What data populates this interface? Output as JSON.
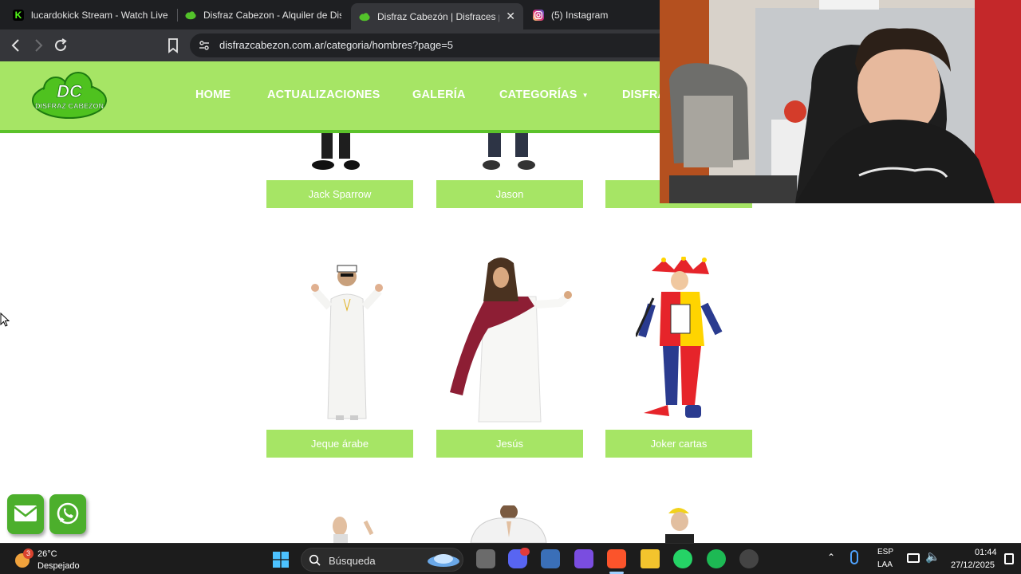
{
  "browser": {
    "tabs": [
      {
        "title": "lucardokick Stream - Watch Live o",
        "favicon": "kick-icon",
        "color": "#53fc18"
      },
      {
        "title": "Disfraz Cabezon - Alquiler de Disfr",
        "favicon": "cloud-icon",
        "color": "#53c22a"
      },
      {
        "title": "Disfraz Cabezón | Disfraces pa",
        "favicon": "cloud-icon",
        "color": "#53c22a",
        "active": true
      },
      {
        "title": "(5) Instagram",
        "favicon": "instagram-icon",
        "color": "#e1306c"
      }
    ],
    "url": "disfrazcabezon.com.ar/categoria/hombres?page=5"
  },
  "site": {
    "logo_initials": "DC",
    "logo_text": "DISFRAZ CABEZON",
    "nav": [
      "HOME",
      "ACTUALIZACIONES",
      "GALERÍA",
      "CATEGORÍAS",
      "DISFRA"
    ],
    "colors": {
      "header": "#a6e565",
      "accent": "#5cc22a",
      "button": "#a6e565"
    }
  },
  "products": {
    "row1": [
      "Jack Sparrow",
      "Jason",
      ""
    ],
    "row2": [
      "Jeque árabe",
      "Jesús",
      "Joker cartas"
    ]
  },
  "contact": {
    "email_icon": "envelope-icon",
    "whatsapp_icon": "whatsapp-icon"
  },
  "taskbar": {
    "weather_temp": "26°C",
    "weather_desc": "Despejado",
    "weather_badge": "3",
    "search_placeholder": "Búsqueda",
    "lang_top": "ESP",
    "lang_bottom": "LAA",
    "time": "01:44",
    "date": "27/12/2025"
  }
}
